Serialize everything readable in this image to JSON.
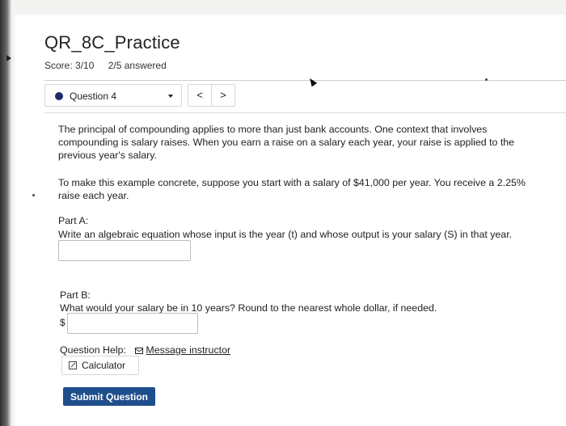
{
  "assignment": {
    "title": "QR_8C_Practice",
    "score": "Score: 3/10",
    "answered": "2/5 answered"
  },
  "question_nav": {
    "selected": "Question 4",
    "prev_label": "<",
    "next_label": ">"
  },
  "question": {
    "paragraph1": "The principal of compounding applies to more than just bank accounts. One context that involves compounding is salary raises. When you earn a raise on a salary each year, your raise is applied to the previous year's salary.",
    "paragraph2": "To make this example concrete, suppose you start with a salary of $41,000 per year. You receive a 2.25% raise each year.",
    "partA_label": "Part A:",
    "partA_text": "Write an algebraic equation whose input is the year (t) and whose output is your salary (S) in that year.",
    "partA_value": "",
    "partB_label": "Part B:",
    "partB_text": "What would your salary be in 10 years? Round to the nearest whole dollar, if needed.",
    "partB_prefix": "$",
    "partB_value": ""
  },
  "help": {
    "label": "Question Help:",
    "message_link": "Message instructor",
    "calculator": "Calculator"
  },
  "submit_label": "Submit Question",
  "colors": {
    "accent": "#1f4e8c",
    "status_dot": "#1b2a6b"
  }
}
